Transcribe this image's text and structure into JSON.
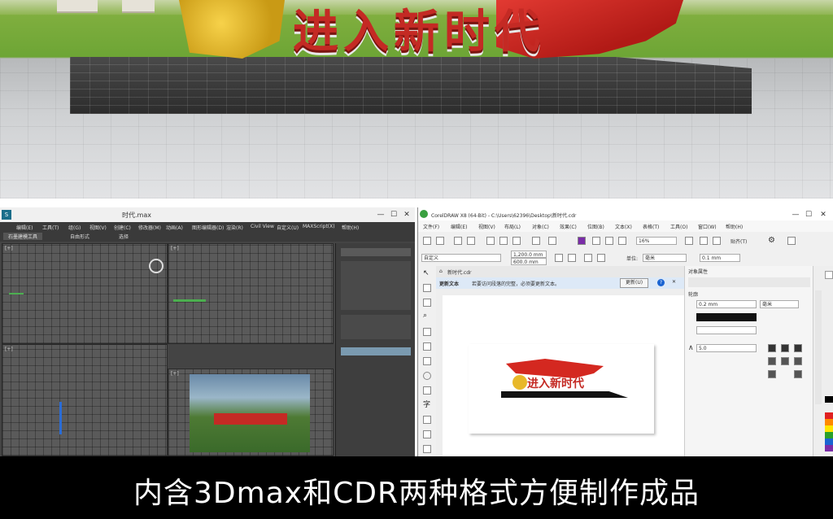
{
  "scene": {
    "title": "进入新时代",
    "colors": {
      "grass": "#6da535",
      "plaza": "#d4d5d7",
      "brick": "#3a3a3a",
      "flag_red": "#c42a24",
      "emblem_gold": "#e8b82a"
    }
  },
  "max_window": {
    "app_icon": "3dsmax-icon",
    "title": "时代.max",
    "window_controls": [
      "—",
      "☐",
      "✕"
    ],
    "menus": [
      "编辑(E)",
      "工具(T)",
      "组(G)",
      "视图(V)",
      "创建(C)",
      "修改器(M)",
      "动画(A)",
      "图形编辑器(D)",
      "渲染(R)",
      "Civil View",
      "自定义(U)",
      "MAXScript(X)",
      "帮助(H)"
    ],
    "tabs": [
      "石墨建模工具",
      "自由形式",
      "选择"
    ],
    "viewport_label": "[+]"
  },
  "cdr_window": {
    "app_icon": "coreldraw-icon",
    "title": "CorelDRAW X8 (64-Bit) - C:\\Users\\62396\\Desktop\\新时代.cdr",
    "window_controls": [
      "—",
      "☐",
      "✕"
    ],
    "menus": [
      "文件(F)",
      "编辑(E)",
      "视图(V)",
      "布局(L)",
      "对象(C)",
      "效果(C)",
      "位图(B)",
      "文本(X)",
      "表格(T)",
      "工具(O)",
      "窗口(W)",
      "帮助(H)"
    ],
    "zoom": "16%",
    "snap_label": "贴齐(T)",
    "page_preset": "自定义",
    "width_value": "1,200.0 mm",
    "height_value": "600.0 mm",
    "units_label": "单位:",
    "units_value": "毫米",
    "nudge_value": "0.1 mm",
    "doc_tab": "新时代.cdr",
    "notice_title": "更新文本",
    "notice_text": "若要访问段落的完整，必须要更新文本。",
    "notice_button": "更新(U)",
    "docker_title": "对象属性",
    "outline_label": "轮廓",
    "outline_width": "0.2 mm",
    "outline_unit": "毫米",
    "miter_value": "5.0",
    "palette_colors": [
      "#ffffff",
      "#000000",
      "#e02020",
      "#ff8a00",
      "#ffe600",
      "#2aa02a",
      "#1a64d2",
      "#7a2ca8",
      "#ff5fb0",
      "#8a5a2b"
    ],
    "artwork_text": "进入新时代"
  },
  "caption": {
    "text": "内含3Dmax和CDR两种格式方便制作成品"
  }
}
